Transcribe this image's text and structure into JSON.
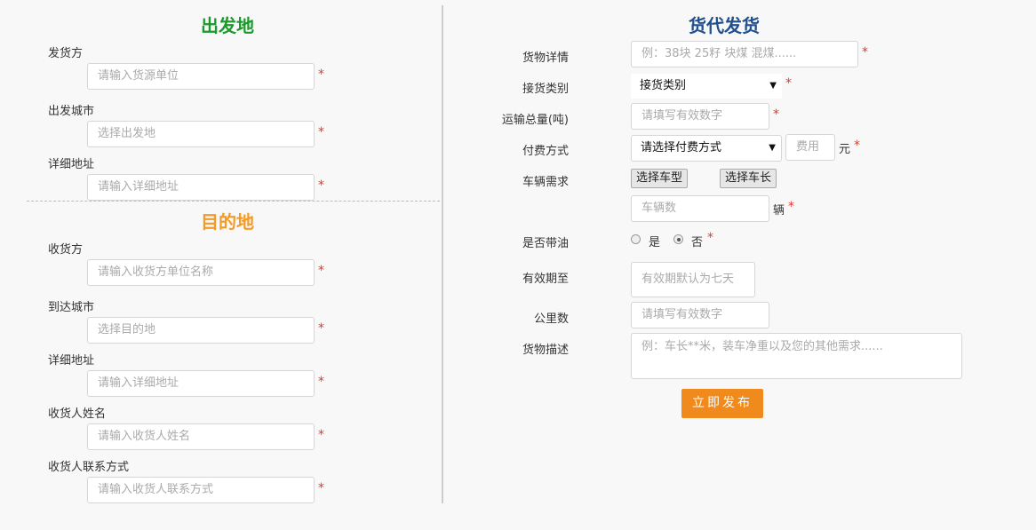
{
  "origin": {
    "title": "出发地",
    "sender": {
      "label": "发货方",
      "placeholder": "请输入货源单位"
    },
    "city": {
      "label": "出发城市",
      "placeholder": "选择出发地"
    },
    "address": {
      "label": "详细地址",
      "placeholder": "请输入详细地址"
    }
  },
  "destination": {
    "title": "目的地",
    "receiver": {
      "label": "收货方",
      "placeholder": "请输入收货方单位名称"
    },
    "city": {
      "label": "到达城市",
      "placeholder": "选择目的地"
    },
    "address": {
      "label": "详细地址",
      "placeholder": "请输入详细地址"
    },
    "contact_name": {
      "label": "收货人姓名",
      "placeholder": "请输入收货人姓名"
    },
    "contact_phone": {
      "label": "收货人联系方式",
      "placeholder": "请输入收货人联系方式"
    }
  },
  "shipping": {
    "title": "货代发货",
    "goods_detail": {
      "label": "货物详情",
      "placeholder": "例：38块 25籽 块煤 混煤......"
    },
    "receive_type": {
      "label": "接货类别",
      "value": "接货类别"
    },
    "total_weight": {
      "label": "运输总量(吨)",
      "placeholder": "请填写有效数字"
    },
    "payment": {
      "label": "付费方式",
      "value": "请选择付费方式",
      "fee_placeholder": "费用",
      "unit": "元"
    },
    "vehicle": {
      "label": "车辆需求",
      "type_button": "选择车型",
      "length_button": "选择车长",
      "count_placeholder": "车辆数",
      "unit": "辆"
    },
    "fuel": {
      "label": "是否带油",
      "yes": "是",
      "no": "否",
      "selected": "否"
    },
    "valid_until": {
      "label": "有效期至",
      "placeholder": "有效期默认为七天"
    },
    "distance": {
      "label": "公里数",
      "placeholder": "请填写有效数字"
    },
    "description": {
      "label": "货物描述",
      "placeholder": "例：车长**米，装车净重以及您的其他需求......"
    },
    "publish_button": "立即发布"
  },
  "required_mark": "*",
  "colors": {
    "green": "#1a9a2a",
    "orange": "#f39a28",
    "blue": "#1f4f8f",
    "button": "#f08a1c",
    "required": "#e23a2a"
  }
}
